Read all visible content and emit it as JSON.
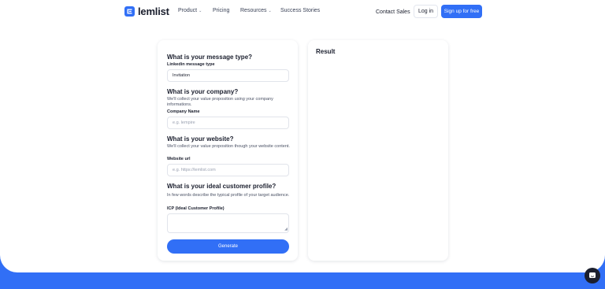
{
  "brand": {
    "name": "lemlist",
    "accent_color": "#316ff6"
  },
  "nav": {
    "items": [
      {
        "label": "Product",
        "has_dropdown": true
      },
      {
        "label": "Pricing",
        "has_dropdown": false
      },
      {
        "label": "Resources",
        "has_dropdown": true
      },
      {
        "label": "Success Stories",
        "has_dropdown": false
      }
    ],
    "contact_label": "Contact Sales",
    "login_label": "Log in",
    "signup_label": "Sign up for free"
  },
  "form": {
    "message_type": {
      "title": "What is your message type?",
      "label": "Linkedin message type",
      "value": "Invitation"
    },
    "company": {
      "title": "What is your company?",
      "description": "We'll collect your value proposition using your company informations.",
      "label": "Company Name",
      "placeholder": "e.g. lempire"
    },
    "website": {
      "title": "What is your website?",
      "description": "We'll collect your value proposition though your website content.",
      "label": "Website url",
      "placeholder": "e.g. https://lemlist.com"
    },
    "icp": {
      "title": "What is your ideal customer profile?",
      "description": "In few words describe the typical profile of your target audience.",
      "label": "ICP (Ideal Customer Profile)",
      "value": ""
    },
    "generate_label": "Generate"
  },
  "result": {
    "title": "Result"
  },
  "icons": {
    "logo": "lemlist-logo-icon",
    "dropdown": "chevron-down-icon",
    "chat": "chat-icon",
    "resize": "resize-handle-icon"
  }
}
